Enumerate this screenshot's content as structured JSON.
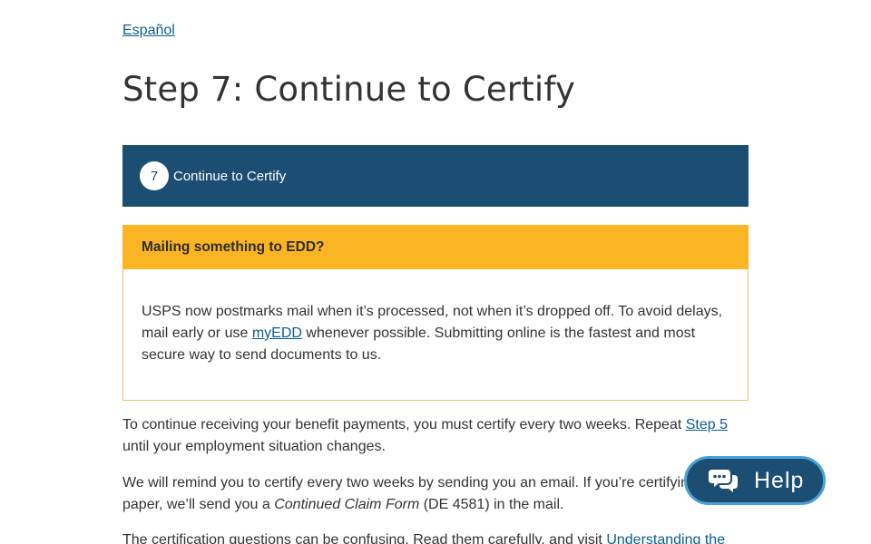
{
  "language_link": "Español",
  "page_title": "Step 7: Continue to Certify",
  "step_banner": {
    "number": "7",
    "label": "Continue to Certify"
  },
  "notice": {
    "heading": "Mailing something to EDD?",
    "text_before": "USPS now postmarks mail when it’s processed, not when it’s dropped off. To avoid delays, mail early or use ",
    "link": "myEDD",
    "text_after": " whenever possible. Submitting online is the fastest and most secure way to send documents to us."
  },
  "paragraph1": {
    "text_before": "To continue receiving your benefit payments, you must certify every two weeks. Repeat ",
    "link": "Step 5",
    "text_after": " until your employment situation changes."
  },
  "paragraph2": {
    "text_before": "We will remind you to certify every two weeks by sending you an email. If you’re certifying by paper, we’ll send you a ",
    "italic": "Continued Claim Form",
    "text_after": " (DE 4581) in the mail."
  },
  "paragraph3": {
    "text_before": "The certification questions can be confusing. Read them carefully, and visit ",
    "link": "Understanding the"
  },
  "help_button": {
    "label": "Help",
    "icon": "chat-bubbles-icon"
  },
  "colors": {
    "banner": "#1c4e74",
    "notice_header": "#fbb524",
    "link": "#0b5d8f",
    "help_border": "#4aa1d6"
  }
}
